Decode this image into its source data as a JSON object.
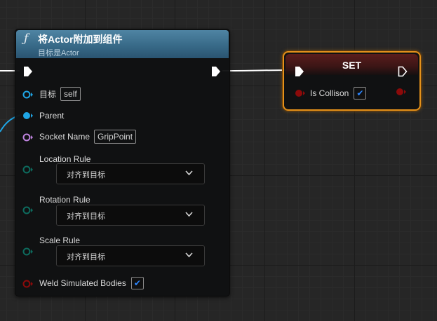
{
  "function_node": {
    "icon": "function-icon",
    "title": "将Actor附加到组件",
    "subtitle": "目标是Actor",
    "pins": {
      "target": {
        "label": "目标",
        "value": "self"
      },
      "parent": {
        "label": "Parent"
      },
      "socket_name": {
        "label": "Socket Name",
        "value": "GripPoint"
      },
      "location_rule": {
        "label": "Location Rule",
        "value": "对齐到目标"
      },
      "rotation_rule": {
        "label": "Rotation Rule",
        "value": "对齐到目标"
      },
      "scale_rule": {
        "label": "Scale Rule",
        "value": "对齐到目标"
      },
      "weld_simulated_bodies": {
        "label": "Weld Simulated Bodies",
        "checked": true
      }
    }
  },
  "set_node": {
    "title": "SET",
    "pin": {
      "label": "Is Collison",
      "checked": true
    }
  },
  "colors": {
    "exec": "#ffffff",
    "object_pin": "#1fa6e6",
    "name_pin": "#c084e0",
    "enum_pin": "#0d6b5e",
    "bool_pin": "#8c0a0a",
    "node_header": "#386a88",
    "selection": "#e4911b"
  },
  "glyphs": {
    "check": "✔",
    "chevron": "⌄"
  }
}
